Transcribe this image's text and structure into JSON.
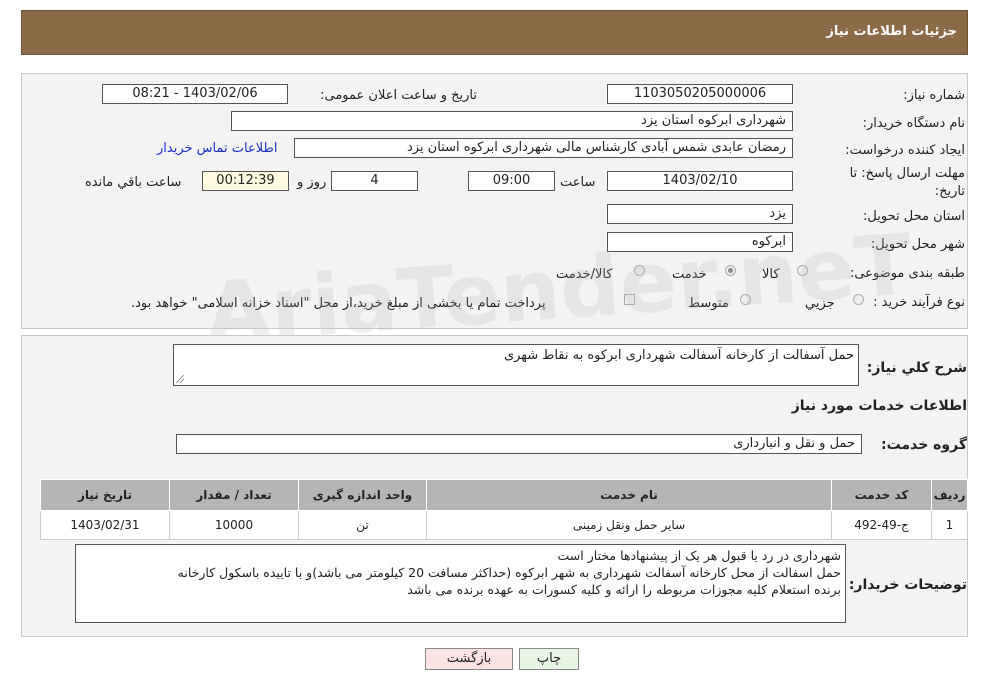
{
  "header": {
    "title": "جزئیات اطلاعات نیاز"
  },
  "info": {
    "need_number_label": "شماره نیاز:",
    "need_number": "1103050205000006",
    "announce_label": "تاریخ و ساعت اعلان عمومی:",
    "announce_value": "1403/02/06 - 08:21",
    "buyer_org_label": "نام دستگاه خریدار:",
    "buyer_org": "شهرداری ابرکوه استان یزد",
    "creator_label": "ایجاد کننده درخواست:",
    "creator": "رمضان عابدی شمس آبادی کارشناس مالی شهرداری ابرکوه استان یزد",
    "contact_link": "اطلاعات تماس خریدار",
    "deadline_label_1": "مهلت ارسال پاسخ: تا",
    "deadline_label_2": "تاریخ:",
    "deadline_date": "1403/02/10",
    "time_label": "ساعت",
    "deadline_time": "09:00",
    "days_value": "4",
    "days_label": "روز و",
    "remaining_time": "00:12:39",
    "remaining_label": "ساعت باقي مانده",
    "province_label": "استان محل تحویل:",
    "province": "یزد",
    "city_label": "شهر محل تحویل:",
    "city": "ابرکوه",
    "category_label": "طبقه بندی موضوعی:",
    "category_options": [
      "کالا",
      "خدمت",
      "کالا/خدمت"
    ],
    "category_selected": "خدمت",
    "process_label": "نوع فرآیند خرید :",
    "process_options": [
      "جزیي",
      "متوسط"
    ],
    "payment_note": "پرداخت تمام یا بخشی از مبلغ خرید،از محل \"اسناد خزانه اسلامی\" خواهد بود."
  },
  "summary": {
    "label": "شرح کلي نياز:",
    "text": "حمل آسفالت از کارخانه آسفالت شهرداری ابرکوه به نقاط شهری"
  },
  "services": {
    "section_title": "اطلاعات خدمات مورد نياز",
    "group_label": "گروه خدمت:",
    "group_value": "حمل و نقل و انبارداری",
    "columns": [
      "رديف",
      "کد خدمت",
      "نام خدمت",
      "واحد اندازه گيری",
      "تعداد / مقدار",
      "تاريخ نياز"
    ],
    "rows": [
      [
        "1",
        "ج-49-492",
        "سایر حمل ونقل زمینی",
        "تن",
        "10000",
        "1403/02/31"
      ]
    ]
  },
  "buyer_notes": {
    "label": "توضيحات خريدار:",
    "lines": [
      "شهرداری در رد یا قبول هر یک از پیشنهادها مختار است",
      "حمل اسفالت از محل کارخانه آسفالت شهرداری به شهر ابرکوه (حداکثر مسافت 20 کیلومتر می باشد)و با تاییده باسکول کارخانه",
      "برنده استعلام کلیه مجوزات مربوطه را ارائه و کلیه کسورات به عهده برنده می باشد"
    ]
  },
  "buttons": {
    "print": "چاپ",
    "back": "بازگشت"
  },
  "watermark": "AriaTender.neT"
}
